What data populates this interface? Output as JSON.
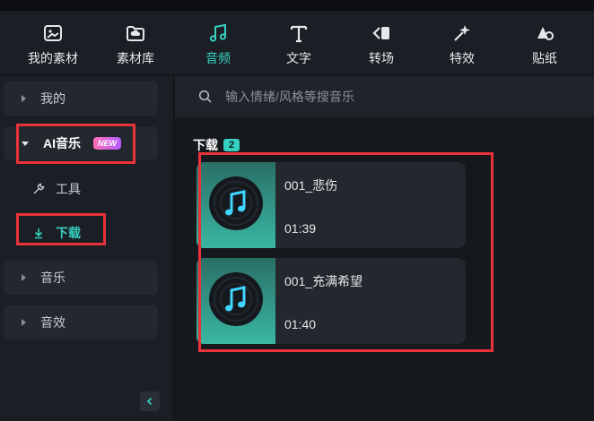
{
  "toolbar": {
    "items": [
      {
        "label": "我的素材",
        "icon": "my-media-icon"
      },
      {
        "label": "素材库",
        "icon": "stock-library-icon"
      },
      {
        "label": "音频",
        "icon": "music-note-icon",
        "active": true
      },
      {
        "label": "文字",
        "icon": "text-icon"
      },
      {
        "label": "转场",
        "icon": "transition-icon"
      },
      {
        "label": "特效",
        "icon": "effects-icon"
      },
      {
        "label": "贴纸",
        "icon": "sticker-icon"
      }
    ]
  },
  "sidebar": {
    "mine": "我的",
    "ai_music": "AI音乐",
    "new_badge": "NEW",
    "tools": "工具",
    "download": "下载",
    "music": "音乐",
    "sfx": "音效"
  },
  "search": {
    "placeholder": "输入情绪/风格等搜音乐"
  },
  "section": {
    "title": "下载",
    "count": "2"
  },
  "tracks": [
    {
      "title": "001_悲伤",
      "duration": "01:39"
    },
    {
      "title": "001_充满希望",
      "duration": "01:40"
    }
  ],
  "colors": {
    "accent": "#36d0c0",
    "highlight_box": "#e8333a"
  }
}
